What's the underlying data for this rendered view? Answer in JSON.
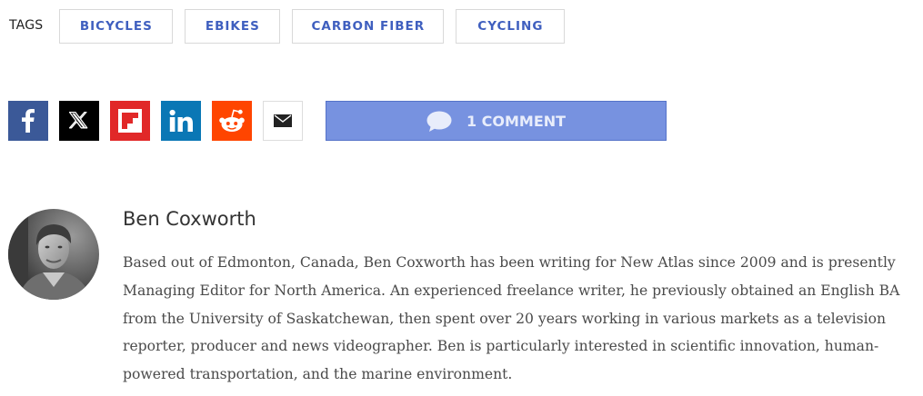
{
  "tags": {
    "label": "TAGS",
    "items": [
      "BICYCLES",
      "EBIKES",
      "CARBON FIBER",
      "CYCLING"
    ]
  },
  "share": {
    "icons": [
      "facebook-icon",
      "x-icon",
      "flipboard-icon",
      "linkedin-icon",
      "reddit-icon",
      "email-icon"
    ],
    "colors": {
      "facebook": "#3b5998",
      "x": "#000000",
      "flipboard": "#e12828",
      "linkedin": "#0a77b5",
      "reddit": "#ff4500",
      "comment": "#7792e0"
    },
    "comment_label": "1 COMMENT"
  },
  "author": {
    "name": "Ben Coxworth",
    "bio": "Based out of Edmonton, Canada, Ben Coxworth has been writing for New Atlas since 2009 and is presently Managing Editor for North America. An experienced freelance writer, he previously obtained an English BA from the University of Saskatchewan, then spent over 20 years working in various markets as a television reporter, producer and news videographer. Ben is particularly interested in scientific innovation, human-powered transportation, and the marine environment."
  },
  "colors": {
    "tag_text": "#3f5fbf",
    "tag_border": "#d9d9d9",
    "name_text": "#333333",
    "bio_text": "#4a4a4a"
  }
}
